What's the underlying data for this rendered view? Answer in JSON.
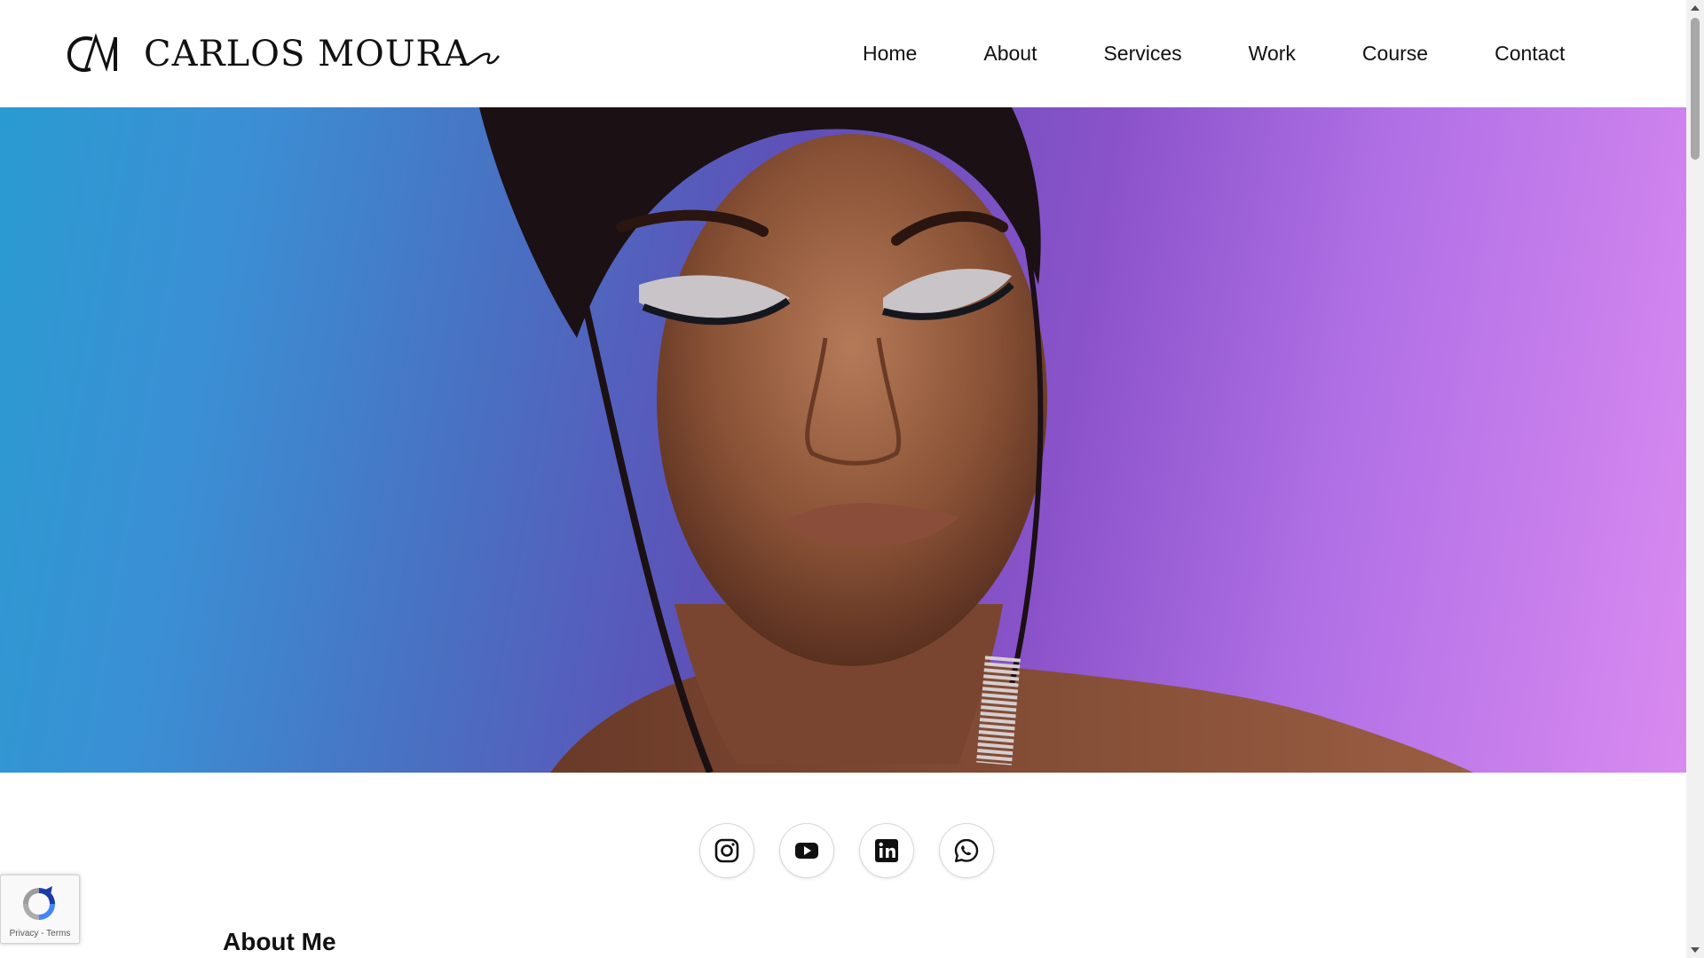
{
  "brand": {
    "name": "CARLOS MOURA",
    "monogram_icon": "cm-monogram-icon"
  },
  "nav": {
    "items": [
      "Home",
      "About",
      "Services",
      "Work",
      "Course",
      "Contact"
    ]
  },
  "hero": {
    "image_icon": "makeup-portrait-image"
  },
  "socials": [
    {
      "name": "Instagram",
      "icon": "instagram-icon"
    },
    {
      "name": "YouTube",
      "icon": "youtube-icon"
    },
    {
      "name": "LinkedIn",
      "icon": "linkedin-icon"
    },
    {
      "name": "WhatsApp",
      "icon": "whatsapp-icon"
    }
  ],
  "about": {
    "title": "About Me"
  },
  "recaptcha": {
    "privacy": "Privacy",
    "separator": " - ",
    "terms": "Terms"
  },
  "colors": {
    "text": "#111111",
    "hero_left": "#2a9bd2",
    "hero_right": "#d98af0"
  }
}
